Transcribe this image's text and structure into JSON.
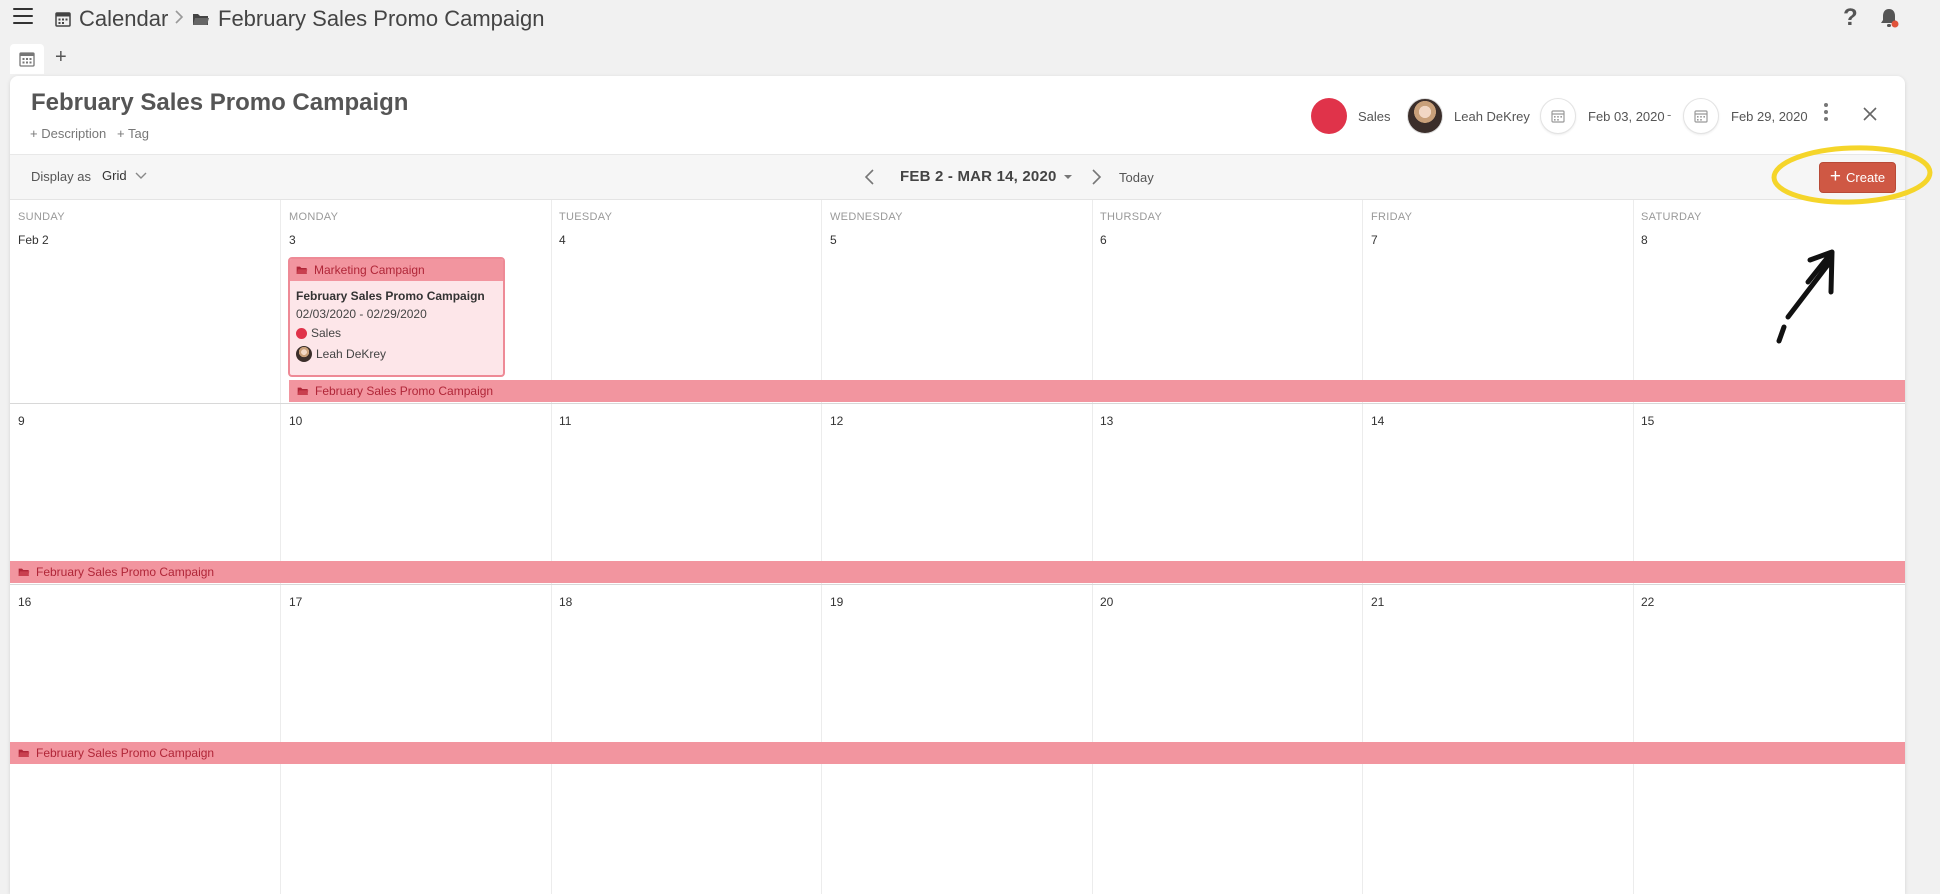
{
  "breadcrumb": {
    "calendar_label": "Calendar",
    "campaign_label": "February Sales Promo Campaign"
  },
  "topbar": {
    "help_glyph": "?"
  },
  "tabs": {
    "add_glyph": "+"
  },
  "header": {
    "title": "February Sales Promo Campaign",
    "description_link": "+ Description",
    "tag_link": "+ Tag",
    "team_label": "Sales",
    "team_color": "#e0334a",
    "owner_name": "Leah DeKrey",
    "start_date": "Feb 03, 2020",
    "date_separator": "-",
    "end_date": "Feb 29, 2020"
  },
  "toolbar": {
    "display_as_label": "Display as",
    "display_as_value": "Grid",
    "range_label": "FEB 2 - MAR 14, 2020",
    "today_label": "Today",
    "create_label": "Create",
    "create_color": "#cf5844"
  },
  "calendar": {
    "day_names": [
      "SUNDAY",
      "MONDAY",
      "TUESDAY",
      "WEDNESDAY",
      "THURSDAY",
      "FRIDAY",
      "SATURDAY"
    ],
    "weeks": [
      {
        "dates": [
          "Feb 2",
          "3",
          "4",
          "5",
          "6",
          "7",
          "8"
        ],
        "band_label": "February Sales Promo Campaign"
      },
      {
        "dates": [
          "9",
          "10",
          "11",
          "12",
          "13",
          "14",
          "15"
        ],
        "band_label": "February Sales Promo Campaign"
      },
      {
        "dates": [
          "16",
          "17",
          "18",
          "19",
          "20",
          "21",
          "22"
        ],
        "band_label": "February Sales Promo Campaign"
      }
    ],
    "band_color": "#f2959f"
  },
  "event_card": {
    "header_label": "Marketing Campaign",
    "title": "February Sales Promo Campaign",
    "date_range": "02/03/2020 - 02/29/2020",
    "team": "Sales",
    "owner": "Leah DeKrey"
  },
  "icons": {
    "menu": "hamburger-icon",
    "calendar": "calendar-icon",
    "folder": "folder-icon",
    "help": "help-icon",
    "bell": "bell-icon",
    "more": "kebab-icon",
    "close": "close-icon"
  },
  "annotation_color": "#f5d52a"
}
